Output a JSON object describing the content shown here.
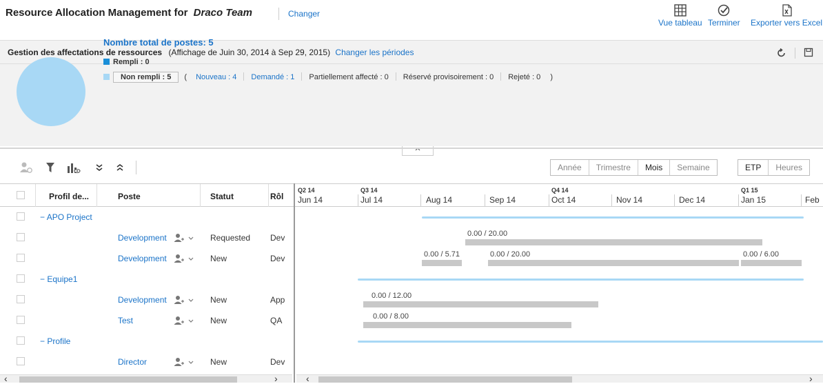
{
  "header": {
    "title_prefix": "Resource Allocation Management for",
    "team": "Draco Team",
    "change_link": "Changer",
    "buttons": [
      {
        "label": "Vue tableau",
        "icon": "table-icon"
      },
      {
        "label": "Terminer",
        "icon": "check-circle-icon"
      },
      {
        "label": "Exporter vers Excel",
        "icon": "excel-export-icon"
      }
    ]
  },
  "summary": {
    "heading": "Gestion des affectations de ressources",
    "period": "(Affichage de Juin 30, 2014 à Sep 29, 2015)",
    "change_periods": "Changer les périodes",
    "total_label": "Nombre total de postes: 5",
    "filled": "Rempli : 0",
    "unfilled": "Non rempli : 5",
    "open_paren": "(",
    "close_paren": ")",
    "new": "Nouveau : 4",
    "requested": "Demandé : 1",
    "partial": "Partiellement affecté : 0",
    "reserved": "Réservé provisoirement : 0",
    "rejected": "Rejeté : 0",
    "filled_color": "#1a8fd8",
    "unfilled_color": "#a8d8f5"
  },
  "toolbar": {
    "period_options": [
      "Année",
      "Trimestre",
      "Mois",
      "Semaine"
    ],
    "period_selected": "Mois",
    "unit_options": [
      "ETP",
      "Heures"
    ],
    "unit_selected": "ETP"
  },
  "grid": {
    "columns": [
      "Profil de...",
      "Poste",
      "Statut",
      "Rôl"
    ],
    "rows": [
      {
        "type": "group",
        "label": "APO Project"
      },
      {
        "type": "item",
        "poste": "Development",
        "statut": "Requested",
        "role": "Dev"
      },
      {
        "type": "item",
        "poste": "Development",
        "statut": "New",
        "role": "Dev"
      },
      {
        "type": "group",
        "label": "Equipe1"
      },
      {
        "type": "item",
        "poste": "Development",
        "statut": "New",
        "role": "App"
      },
      {
        "type": "item",
        "poste": "Test",
        "statut": "New",
        "role": "QA"
      },
      {
        "type": "group",
        "label": "Profile"
      },
      {
        "type": "item",
        "poste": "Director",
        "statut": "New",
        "role": "Dev"
      }
    ]
  },
  "timeline": {
    "quarters": [
      "Q2 14",
      "Q3 14",
      "Q4 14",
      "Q1 15"
    ],
    "months": [
      "Jun 14",
      "Jul 14",
      "Aug 14",
      "Sep 14",
      "Oct 14",
      "Nov 14",
      "Dec 14",
      "Jan 15",
      "Feb"
    ],
    "bar_labels": [
      "0.00 / 20.00",
      "0.00 / 5.71",
      "0.00 / 20.00",
      "0.00 / 6.00",
      "0.00 / 12.00",
      "0.00 / 8.00"
    ]
  },
  "colors": {
    "accent": "#1a73c8",
    "bar": "#c8c8c8",
    "group_line": "#a8d8f5"
  }
}
